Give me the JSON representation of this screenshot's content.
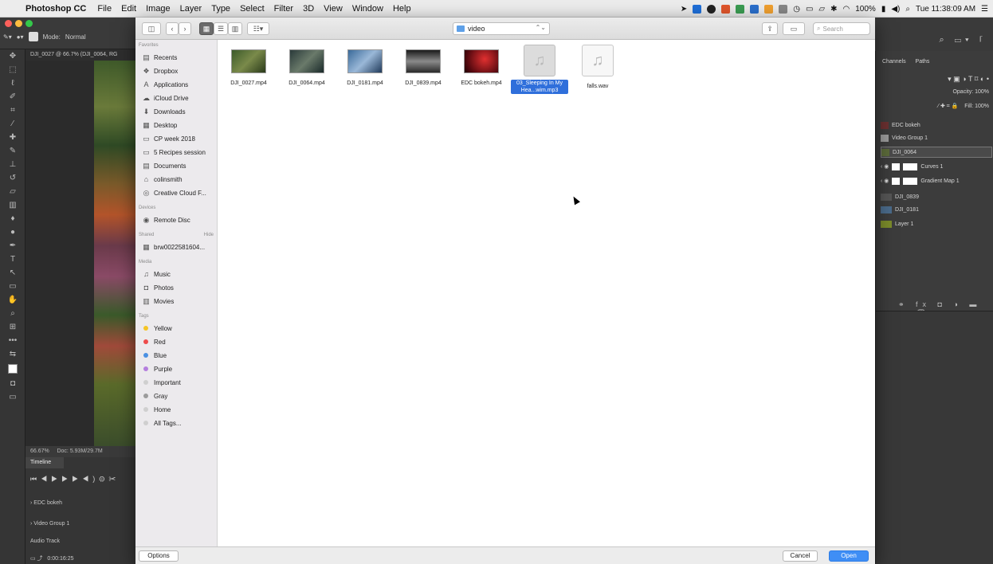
{
  "menubar": {
    "app": "Photoshop CC",
    "menus": [
      "File",
      "Edit",
      "Image",
      "Layer",
      "Type",
      "Select",
      "Filter",
      "3D",
      "View",
      "Window",
      "Help"
    ],
    "battery": "100%",
    "clock": "Tue 11:38:09 AM"
  },
  "photoshop": {
    "doc_tab": "DJI_0027 @ 66.7% (DJI_0064, RG",
    "mode_label": "Mode:",
    "mode_value": "Normal",
    "zoom": "66.67%",
    "doc_size": "Doc: 5.93M/29.7M",
    "timeline": {
      "tab": "Timeline",
      "rows": [
        "EDC bokeh",
        "Video Group 1",
        "Audio Track"
      ],
      "time": "0:00:16:25"
    },
    "panels": {
      "tabs": [
        "Channels",
        "Paths"
      ],
      "opacity": "Opacity: 100%",
      "fill": "Fill: 100%",
      "layers": [
        "EDC bokeh",
        "Video Group 1",
        "DJI_0064",
        "Curves 1",
        "Gradient Map 1",
        "DJI_0839",
        "DJI_0181",
        "Layer 1"
      ]
    }
  },
  "dialog": {
    "current_folder": "video",
    "search_placeholder": "Search",
    "sidebar": {
      "favorites_label": "Favorites",
      "favorites": [
        {
          "icon": "recents-icon",
          "label": "Recents"
        },
        {
          "icon": "dropbox-icon",
          "label": "Dropbox"
        },
        {
          "icon": "applications-icon",
          "label": "Applications"
        },
        {
          "icon": "cloud-icon",
          "label": "iCloud Drive"
        },
        {
          "icon": "downloads-icon",
          "label": "Downloads"
        },
        {
          "icon": "desktop-icon",
          "label": "Desktop"
        },
        {
          "icon": "folder-icon",
          "label": "CP week 2018"
        },
        {
          "icon": "folder-icon",
          "label": "5 Recipes session"
        },
        {
          "icon": "documents-icon",
          "label": "Documents"
        },
        {
          "icon": "home-icon",
          "label": "colinsmith"
        },
        {
          "icon": "creative-cloud-icon",
          "label": "Creative Cloud F..."
        }
      ],
      "devices_label": "Devices",
      "devices": [
        {
          "icon": "disc-icon",
          "label": "Remote Disc"
        }
      ],
      "shared_label": "Shared",
      "shared_hide": "Hide",
      "shared": [
        {
          "icon": "server-icon",
          "label": "brw0022581604..."
        }
      ],
      "media_label": "Media",
      "media": [
        {
          "icon": "music-icon",
          "label": "Music"
        },
        {
          "icon": "photos-icon",
          "label": "Photos"
        },
        {
          "icon": "movies-icon",
          "label": "Movies"
        }
      ],
      "tags_label": "Tags",
      "tags": [
        {
          "label": "Yellow",
          "color": "#f5c526"
        },
        {
          "label": "Red",
          "color": "#ee4b4b"
        },
        {
          "label": "Blue",
          "color": "#4a90e2"
        },
        {
          "label": "Purple",
          "color": "#b47ede"
        },
        {
          "label": "Important",
          "color": "#cfcfcf"
        },
        {
          "label": "Gray",
          "color": "#9c9c9c"
        },
        {
          "label": "Home",
          "color": "#cfcfcf"
        },
        {
          "label": "All Tags...",
          "color": "#cfcfcf"
        }
      ]
    },
    "files": [
      {
        "name": "DJI_0027.mp4",
        "kind": "video"
      },
      {
        "name": "DJI_0064.mp4",
        "kind": "video"
      },
      {
        "name": "DJI_0181.mp4",
        "kind": "video"
      },
      {
        "name": "DJI_0839.mp4",
        "kind": "video"
      },
      {
        "name": "EDC bokeh.mp4",
        "kind": "video"
      },
      {
        "name": "03_Sleeping In My Hea...wim.mp3",
        "kind": "audio",
        "selected": true
      },
      {
        "name": "falls.wav",
        "kind": "audio"
      }
    ],
    "footer": {
      "options": "Options",
      "cancel": "Cancel",
      "open": "Open"
    }
  }
}
